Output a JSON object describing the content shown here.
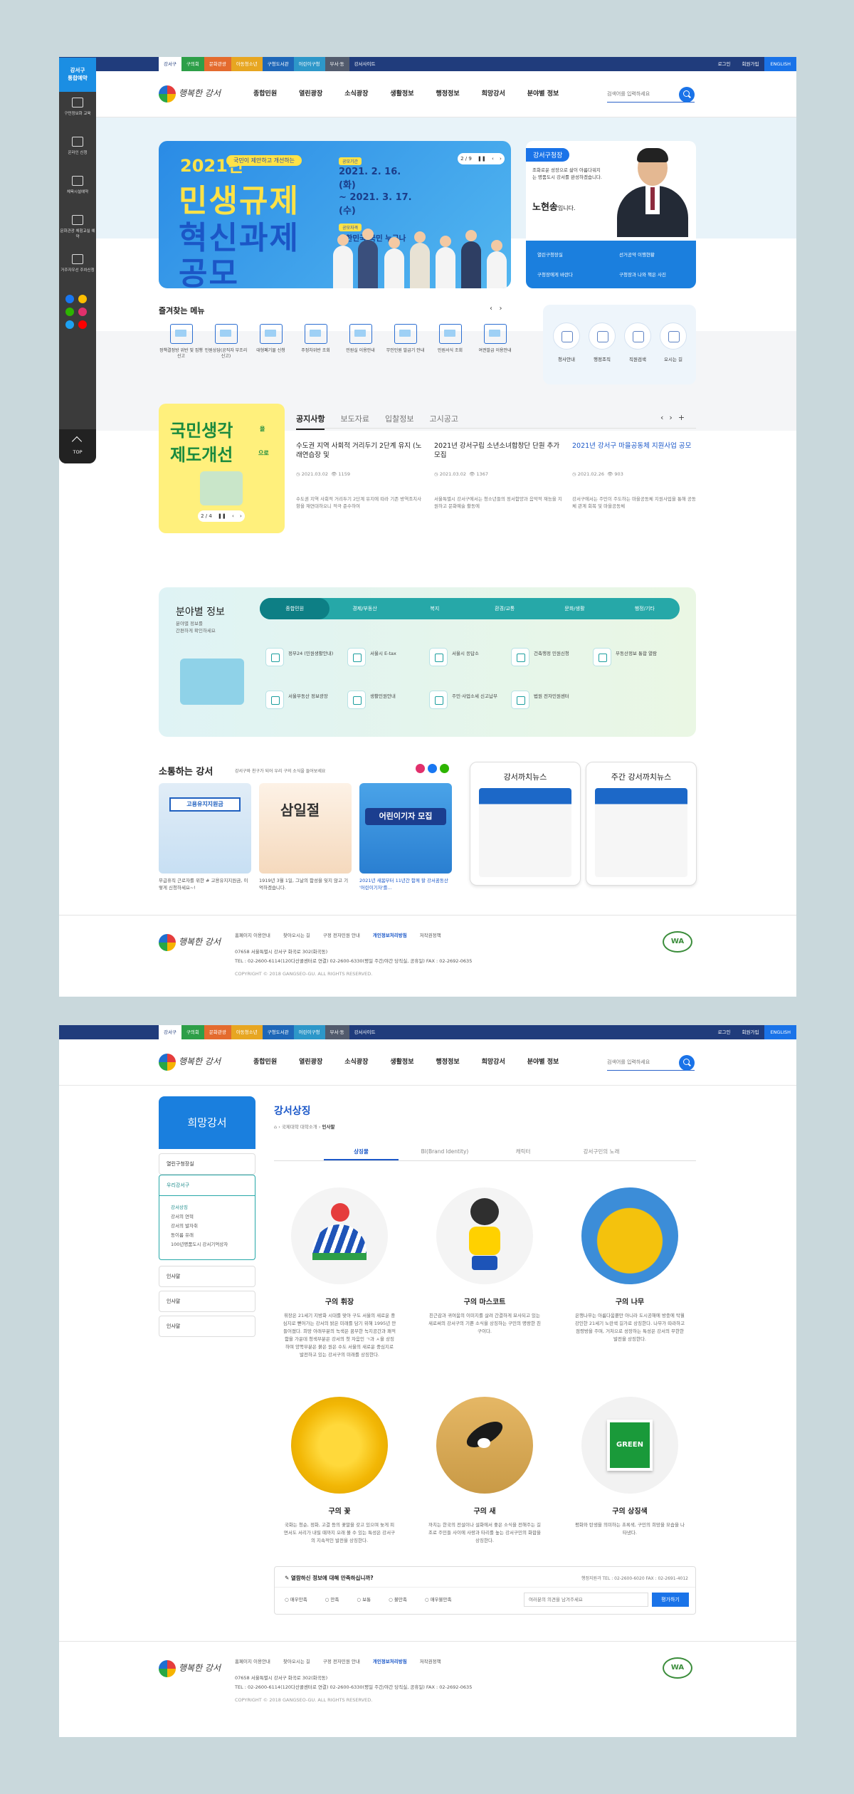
{
  "util": {
    "items": [
      "강서구",
      "구의회",
      "문화관광",
      "아동청소년",
      "지역주택개발",
      "구청도서관",
      "어린이구청",
      "부서·동",
      "강서사이트"
    ],
    "colors": [
      "#fff",
      "#2d9f48",
      "#e46b2e",
      "#e7a621",
      "#1f67b8",
      "#2d97c9",
      "#4c6ec6",
      "#525b6d",
      "#203c7c"
    ],
    "right": [
      "로그인",
      "회원가입",
      "ENGLISH"
    ]
  },
  "logo": {
    "text": "행복한 강서"
  },
  "menu": [
    "종합민원",
    "열린광장",
    "소식광장",
    "생활정보",
    "행정정보",
    "희망강서",
    "분야별 정보"
  ],
  "search": {
    "placeholder": "검색어를 입력하세요"
  },
  "quick": {
    "head": [
      "강서구",
      "통합예약"
    ],
    "items": [
      "구민정보화 교육",
      "온라인 신청",
      "체육시설예약",
      "문화관광 체험교실 예약",
      "거주자우선 주차신청"
    ],
    "sns_colors": [
      "#1877f2",
      "#ffbf00",
      "#2db400",
      "#e1306c",
      "#1da1f2",
      "#ff0000"
    ],
    "top": "TOP"
  },
  "banner": {
    "year": "2021년",
    "tag": "국민이 제안하고 개선하는",
    "title1": "민생규제",
    "title2": "혁신과제",
    "title3": "공모",
    "period_label": "공모기간",
    "period_from": "2021. 2. 16.(화)",
    "period_to": "~ 2021. 3. 17.(수)",
    "target_label": "공모자격",
    "target": "대한민국 국민 누구나",
    "pager": "2 / 9"
  },
  "mayor": {
    "tag": "강서구청장",
    "desc": "조화로운 성장으로 삶이 아름다워지는 명품도시 강서를 완성하겠습니다.",
    "name": "노현송",
    "name_suffix": "입니다.",
    "links": [
      "열린구청장실",
      "선거공약 이행현황",
      "구청장에게 바란다",
      "구청장과 나와 책은 사진"
    ]
  },
  "favorites": {
    "title": "즐겨찾는 메뉴",
    "items": [
      "정책결정방 위반 및 집행신고",
      "민원상담(공직자 부조리신고)",
      "대형폐기물 신청",
      "주정차위반 조회",
      "민원실 이용안내",
      "무인민원 발급기 안내",
      "민원서식 조회",
      "여권발급 이용안내"
    ]
  },
  "services": [
    "청사안내",
    "행정조직",
    "직원검색",
    "오시는 길"
  ],
  "campaign": {
    "line1": "국민생각",
    "suffix1": "을",
    "line2": "제도개선",
    "suffix2": "으로",
    "pager": "2 / 4"
  },
  "notice": {
    "tabs": [
      "공지사항",
      "보도자료",
      "입찰정보",
      "고시공고"
    ],
    "items": [
      {
        "title": "수도권 지역 사회적 거리두기 2단계 유지 (노래연습장 및",
        "date": "2021.03.02",
        "views": "1159",
        "body": "수도권 지역 사회적 거리두기 2단계 유지에 따라 기존 방역조치사항을 재연대하오니 적극 준수하여"
      },
      {
        "title": "2021년 강서구립 소년소녀합창단 단원 추가모집",
        "date": "2021.03.02",
        "views": "1367",
        "body": "서울특별시 강서구에서는 청소년들의 정서함양과 음악적 재능을 지원하고 문화예술 활동에"
      },
      {
        "title": "2021년 강서구 마을공동체 지원사업 공모",
        "date": "2021.02.26",
        "views": "903",
        "body": "강서구에서는 주민이 주도하는 마을공동체 지원사업을 통해 공동체 관계 회복 및 마을공동체"
      }
    ]
  },
  "field": {
    "title": "분야별 정보",
    "sub1": "분야별 정보를",
    "sub2": "간편하게 확인하세요",
    "tabs": [
      "종합민원",
      "경제/부동산",
      "복지",
      "환경/교통",
      "문화/생활",
      "행정/기타"
    ],
    "items": [
      "정부24 (민원생활안내)",
      "서울시 E-tax",
      "서울시 응답소",
      "건축행정 민원신청",
      "부동산정보 통합 열람",
      "서울부동산 정보광장",
      "생활민원안내",
      "주민·사업소세 신고납부",
      "법원 전자민원센터"
    ]
  },
  "comm": {
    "title": "소통하는 강서",
    "sub": "강서구와 친구가 되어 우리 구의 소식을 들어보세요",
    "cards": [
      {
        "head": "고용유지지원금",
        "cap": "무급휴직 근로자를 위한 # 고용유지지원금, 이렇게 신청하세요~!"
      },
      {
        "head": "삼일절",
        "cap": "1919년 3월 1일, 그날의 함성을 잊지 않고 기억하겠습니다."
      },
      {
        "head": "어린이기자 모집",
        "cap": "2021년 새봄부터 11년간 함께 할 강서꿈동산 '어린이기자'를..."
      }
    ],
    "news": [
      "강서까치뉴스",
      "주간 강서까치뉴스"
    ]
  },
  "footer": {
    "links": [
      "홈페이지 이용안내",
      "찾아오시는 길",
      "구정 전자민원 안내",
      "개인정보처리방침",
      "저작권정책"
    ],
    "addr": "07658 서울특별시 강서구 화곡로 302(화곡동)",
    "tel": "TEL : 02-2600-6114(120다산콜센터로 연결) 02-2600-6330(평일 주간/야간 당직실, 공휴일) FAX : 02-2692-0635",
    "copy": "COPYRIGHT © 2018 GANGSEO-GU. ALL RIGHTS RESERVED.",
    "wa": "WA"
  },
  "sub": {
    "lnb_title": "희망강서",
    "lnb_items": [
      "열린구청장실",
      "우리강서구",
      "인사말",
      "인사말",
      "인사말"
    ],
    "lnb_sub": [
      "강서상징",
      "강서의 연혁",
      "강서의 발자취",
      "동이름 유래",
      "100년명품도시 강서기억상자"
    ],
    "title": "강서상징",
    "bread": [
      "국제대학 대학소개",
      "인사말"
    ],
    "tabs": [
      "상징물",
      "BI(Brand Identity)",
      "캐릭터",
      "강서구민의 노래"
    ],
    "symbols": [
      {
        "name": "구의 휘장",
        "desc": "휘장은 21세기 지방화 시대를 맞아 구도 서울의 새로운 중심지로 뻗어가는 강서의 밝은 미래를 담기 위해 1995년 만들어졌다. 희망 아래부분의 녹색은 꿈부한 녹지공간과 쾌적함을 가운데 청색부분은 강서의 첫 자음인 ㄱ과 ㅅ을 상징하며 양쪽부분은 붉은 원은 수도 서울의 새로운 중심지로 발전하고 있는 강서구의 미래를 상징한다."
      },
      {
        "name": "구의 마스코트",
        "desc": "친근감과 귀여움의 이미지를 살려 간결하게 묘사되고 있는 새로써의 강서구의 기쁜 소식을 상징하는 구민의 명랑한 친구이다."
      },
      {
        "name": "구의 나무",
        "desc": "은행나무는 아름다움뿐만 아니라 도시공해에 방충에 탁월 강인한 21세기 노란색 길가로 상징한다. 나무가 따라하고 점령방을 주며, 거처으로 성장하는 특성은 강서의 무한한 발전을 상징한다."
      },
      {
        "name": "구의 꽃",
        "desc": "국화는 청순, 정화, 고결 등의 꽃말을 갖고 있으며 늦게 피면서도 서리가 내릴 때까지 오래 볼 수 있는 특성은 강서구의 지속적인 발전을 상징한다."
      },
      {
        "name": "구의 새",
        "desc": "까치는 한국의 전설이나 설화에서 좋은 소식을 전해주는 길조로 주민들 사이에 사랑과 타리를 높는 강서구민의 화합을 상징한다."
      },
      {
        "name": "구의 상징색",
        "desc": "평화와 탄생을 의미하는 초록색, 구민의 희망을 모습을 나타낸다.",
        "chip": "GREEN"
      }
    ],
    "survey": {
      "q": "열람하신 정보에 대해 만족하십니까?",
      "info": "행정지원과 TEL : 02-2600-6020  FAX : 02-2691-4012",
      "options": [
        "매우만족",
        "만족",
        "보통",
        "불만족",
        "매우불만족"
      ],
      "placeholder": "여러분의 의견을 남겨주세요",
      "submit": "평가하기"
    }
  }
}
